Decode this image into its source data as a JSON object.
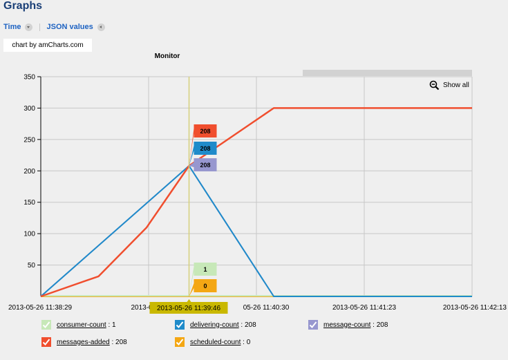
{
  "page": {
    "title": "Graphs"
  },
  "tabs": [
    {
      "label": "Time",
      "icon": "chevron-down-icon"
    },
    {
      "label": "JSON values",
      "icon": "chevron-left-icon"
    }
  ],
  "credit": "chart by amCharts.com",
  "show_all": "Show all",
  "chart_data": {
    "type": "line",
    "title": "Monitor",
    "x_axis_type": "datetime",
    "x_tick_labels": [
      "2013-05-26 11:38:29",
      "2013-05-26 11:",
      "05-26 11:40:30",
      "2013-05-26 11:41:23",
      "2013-05-26 11:42:13"
    ],
    "xlim": [
      "2013-05-26 11:38:29",
      "2013-05-26 11:42:13"
    ],
    "ylim": [
      0,
      350
    ],
    "y_ticks": [
      50,
      100,
      150,
      200,
      250,
      300,
      350
    ],
    "grid": true,
    "cursor": {
      "x": "2013-05-26 11:39:46",
      "label": "2013-05-26 11:39:46",
      "balloons": [
        {
          "series": "messages-added",
          "value": "208"
        },
        {
          "series": "delivering-count",
          "value": "208"
        },
        {
          "series": "message-count",
          "value": "208"
        },
        {
          "series": "consumer-count",
          "value": "1"
        },
        {
          "series": "scheduled-count",
          "value": "0"
        }
      ]
    },
    "series": [
      {
        "name": "messages-added",
        "color": "#f04e2e",
        "x": [
          "2013-05-26 11:38:29",
          "2013-05-26 11:38:59",
          "2013-05-26 11:39:24",
          "2013-05-26 11:39:46",
          "2013-05-26 11:40:30",
          "2013-05-26 11:42:13"
        ],
        "values": [
          0,
          32,
          110,
          208,
          300,
          300
        ]
      },
      {
        "name": "delivering-count",
        "color": "#1f8bca",
        "x": [
          "2013-05-26 11:38:29",
          "2013-05-26 11:39:46",
          "2013-05-26 11:40:30",
          "2013-05-26 11:42:13"
        ],
        "values": [
          0,
          208,
          0,
          0
        ]
      },
      {
        "name": "message-count",
        "color": "#9797cf",
        "x": [
          "2013-05-26 11:38:29",
          "2013-05-26 11:39:46",
          "2013-05-26 11:40:30",
          "2013-05-26 11:42:13"
        ],
        "values": [
          0,
          208,
          0,
          0
        ]
      },
      {
        "name": "consumer-count",
        "color": "#c7e8b8",
        "x": [
          "2013-05-26 11:38:29",
          "2013-05-26 11:39:46",
          "2013-05-26 11:42:13"
        ],
        "values": [
          1,
          1,
          1
        ]
      },
      {
        "name": "scheduled-count",
        "color": "#f4a714",
        "x": [
          "2013-05-26 11:38:29",
          "2013-05-26 11:39:46",
          "2013-05-26 11:42:13"
        ],
        "values": [
          0,
          0,
          0
        ]
      }
    ],
    "legend": {
      "position": "bottom",
      "items": [
        {
          "name": "consumer-count",
          "value": " : 1",
          "color": "#c7e8b8"
        },
        {
          "name": "delivering-count",
          "value": " : 208",
          "color": "#1f8bca"
        },
        {
          "name": "message-count",
          "value": " : 208",
          "color": "#9797cf"
        },
        {
          "name": "messages-added",
          "value": " : 208",
          "color": "#f04e2e"
        },
        {
          "name": "scheduled-count",
          "value": " : 0",
          "color": "#f4a714"
        }
      ]
    }
  }
}
